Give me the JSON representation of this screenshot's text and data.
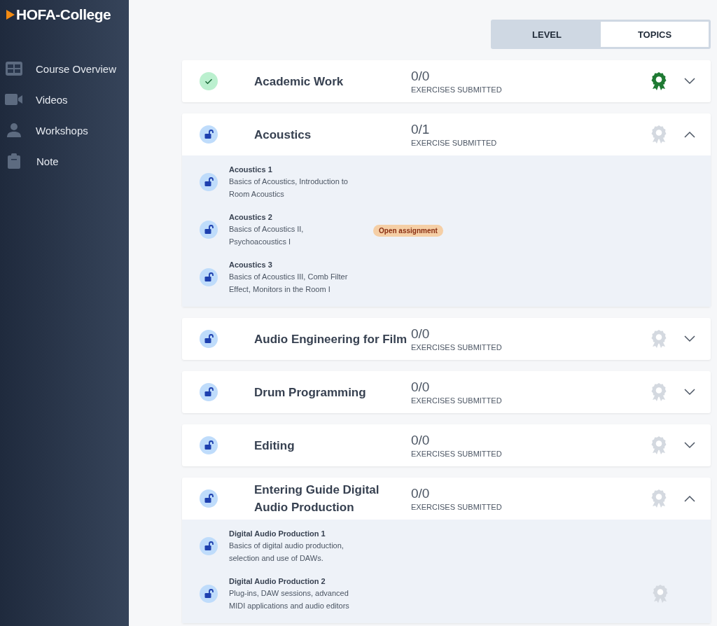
{
  "sidebar": {
    "logo": "HOFA-College",
    "items": [
      {
        "label": "Course Overview"
      },
      {
        "label": "Videos"
      },
      {
        "label": "Workshops"
      },
      {
        "label": "Note"
      }
    ]
  },
  "view_toggle": [
    {
      "label": "LEVEL",
      "selected": false
    },
    {
      "label": "TOPICS",
      "selected": true
    }
  ],
  "topics": [
    {
      "title": "Academic Work",
      "completed": true,
      "count": "0/0",
      "count_label": "EXERCISES SUBMITTED",
      "award_earned": true,
      "expanded": false
    },
    {
      "title": "Acoustics",
      "completed": false,
      "count": "0/1",
      "count_label": "EXERCISE SUBMITTED",
      "award_earned": false,
      "expanded": true,
      "lessons": [
        {
          "title": "Acoustics 1",
          "description": "Basics of Acoustics, Introduction to Room Acoustics",
          "award": false
        },
        {
          "title": "Acoustics 2",
          "description": "Basics of Acoustics II, Psychoacoustics I",
          "badge": "Open assignment",
          "award": false
        },
        {
          "title": "Acoustics 3",
          "description": "Basics of Acoustics III, Comb Filter Effect, Monitors in the Room I",
          "award": false
        }
      ]
    },
    {
      "title": "Audio Engineering for Film",
      "completed": false,
      "count": "0/0",
      "count_label": "EXERCISES SUBMITTED",
      "award_earned": false,
      "expanded": false
    },
    {
      "title": "Drum Programming",
      "completed": false,
      "count": "0/0",
      "count_label": "EXERCISES SUBMITTED",
      "award_earned": false,
      "expanded": false
    },
    {
      "title": "Editing",
      "completed": false,
      "count": "0/0",
      "count_label": "EXERCISES SUBMITTED",
      "award_earned": false,
      "expanded": false
    },
    {
      "title": "Entering Guide Digital Audio Production",
      "completed": false,
      "count": "0/0",
      "count_label": "EXERCISES SUBMITTED",
      "award_earned": false,
      "expanded": true,
      "lessons": [
        {
          "title": "Digital Audio Production 1",
          "description": "Basics of digital audio production, selection and use of DAWs.",
          "award": false
        },
        {
          "title": "Digital Audio Production 2",
          "description": "Plug-ins, DAW sessions, advanced MIDI applications and audio editors",
          "award": true
        }
      ]
    }
  ]
}
